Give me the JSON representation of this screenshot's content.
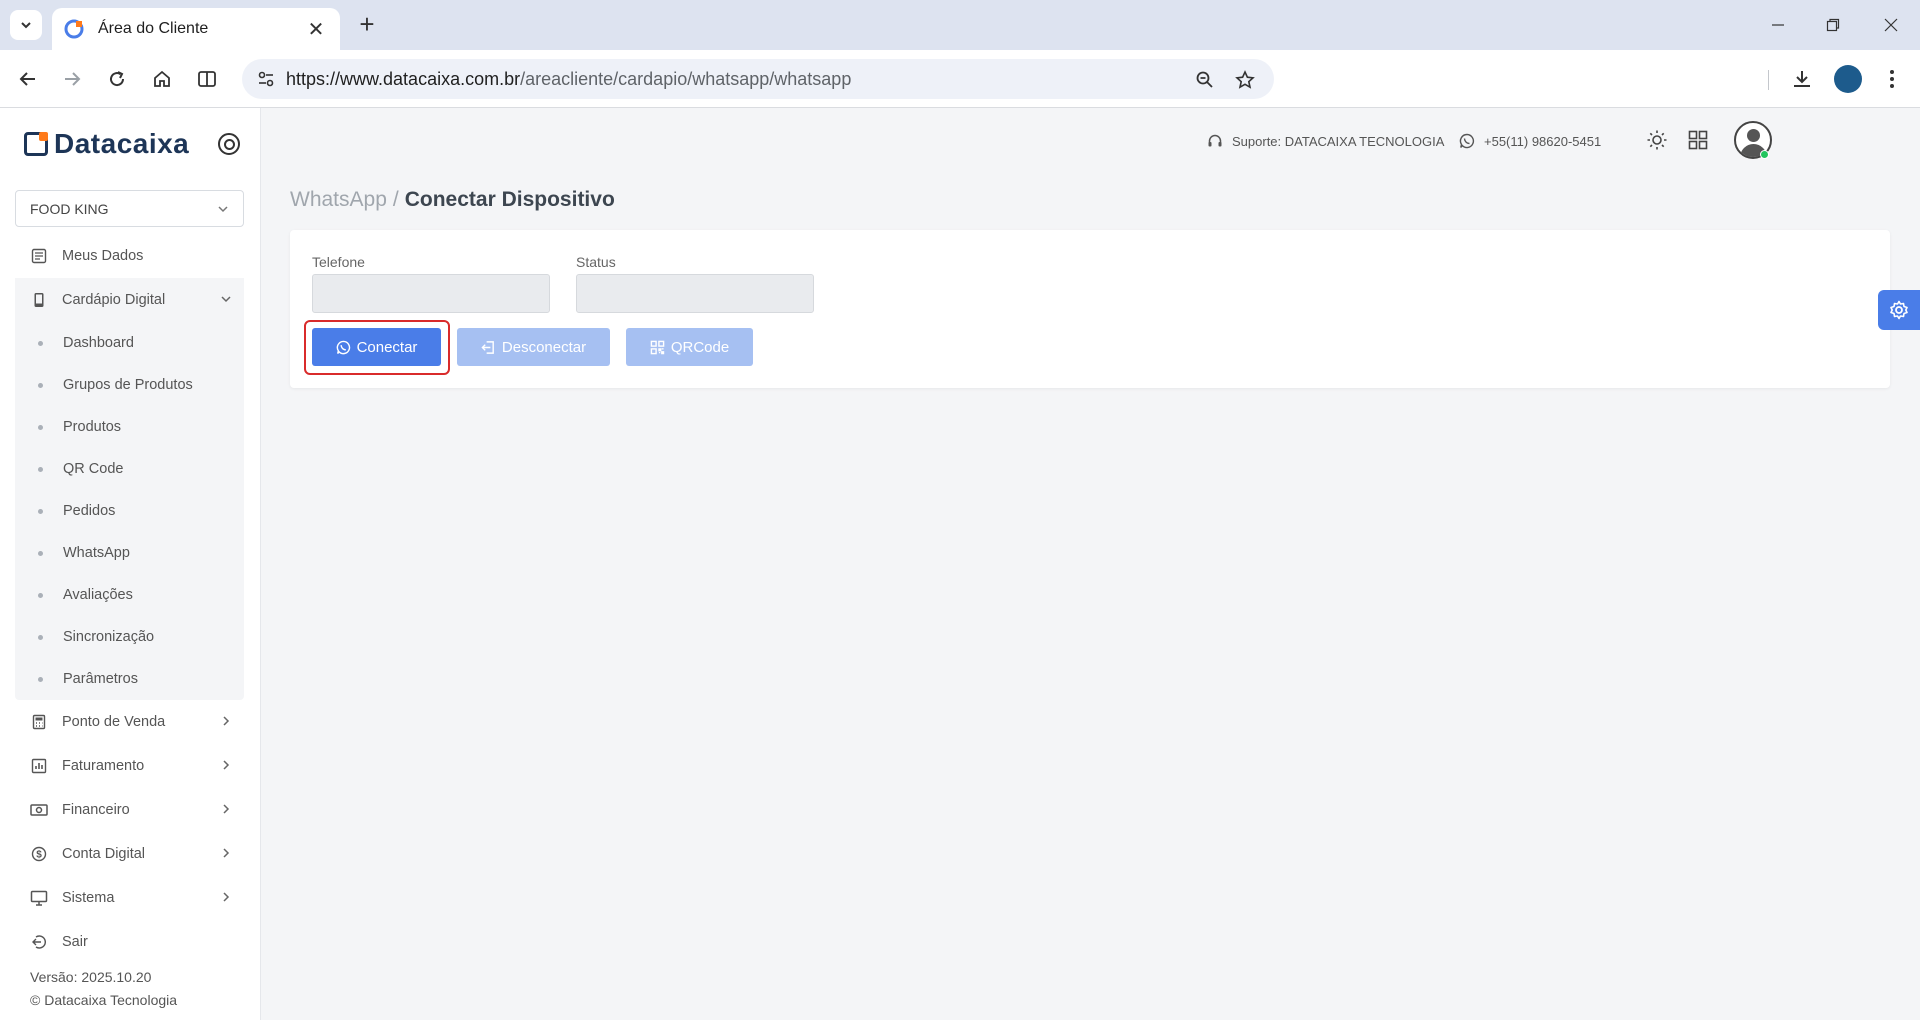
{
  "browser": {
    "tab_title": "Área do Cliente",
    "url_host": "https://www.datacaixa.com.br",
    "url_path": "/areacliente/cardapio/whatsapp/whatsapp"
  },
  "brand": {
    "name": "Datacaixa",
    "accent": "#ff7a1a",
    "primary": "#1d3557"
  },
  "sidebar": {
    "company": "FOOD KING",
    "items": [
      {
        "label": "Meus Dados",
        "icon": "id-card-icon"
      },
      {
        "label": "Cardápio Digital",
        "icon": "phone-icon"
      },
      {
        "label": "Ponto de Venda",
        "icon": "calculator-icon"
      },
      {
        "label": "Faturamento",
        "icon": "bar-chart-icon"
      },
      {
        "label": "Financeiro",
        "icon": "money-icon"
      },
      {
        "label": "Conta Digital",
        "icon": "dollar-icon"
      },
      {
        "label": "Sistema",
        "icon": "monitor-icon"
      },
      {
        "label": "Sair",
        "icon": "logout-icon"
      }
    ],
    "submenu": [
      "Dashboard",
      "Grupos de Produtos",
      "Produtos",
      "QR Code",
      "Pedidos",
      "WhatsApp",
      "Avaliações",
      "Sincronização",
      "Parâmetros"
    ],
    "version": "Versão: 2025.10.20",
    "copyright": "© Datacaixa Tecnologia"
  },
  "header": {
    "support": "Suporte: DATACAIXA TECNOLOGIA",
    "phone": "+55(11) 98620-5451"
  },
  "breadcrumb": {
    "parent": "WhatsApp",
    "separator": "/",
    "current": "Conectar Dispositivo"
  },
  "form": {
    "telefone_label": "Telefone",
    "telefone_value": "",
    "status_label": "Status",
    "status_value": "",
    "btn_conectar": "Conectar",
    "btn_desconectar": "Desconectar",
    "btn_qrcode": "QRCode"
  },
  "colors": {
    "button_primary": "#4a7de8",
    "button_disabled": "#a6c0f2",
    "highlight": "#d92b2b"
  }
}
